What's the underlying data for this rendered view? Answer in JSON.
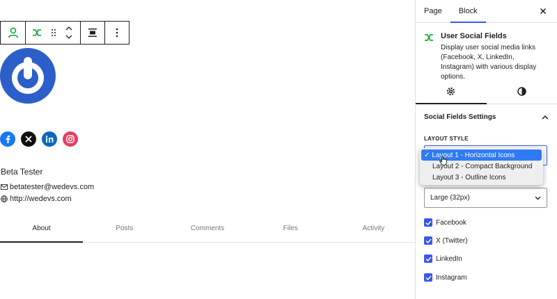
{
  "toolbar": {
    "buttons": [
      "block-type",
      "drag",
      "move",
      "align",
      "options"
    ]
  },
  "social_icons": [
    {
      "name": "facebook",
      "glyph": "f",
      "color": "#1877f2"
    },
    {
      "name": "x",
      "glyph": "X",
      "color": "#000000"
    },
    {
      "name": "linkedin",
      "glyph": "in",
      "color": "#0a66c2"
    },
    {
      "name": "instagram",
      "glyph": "◎",
      "color": "#e4405f"
    }
  ],
  "profile": {
    "name": "Beta Tester",
    "email": "betatester@wedevs.com",
    "url": "http://wedevs.com"
  },
  "profile_tabs": [
    "About",
    "Posts",
    "Comments",
    "Files",
    "Activity"
  ],
  "sidebar": {
    "tabs": [
      "Page",
      "Block"
    ],
    "block_title": "User Social Fields",
    "block_description": "Display user social media links (Facebook, X, LinkedIn, Instagram) with various display options.",
    "panel_title": "Social Fields Settings",
    "layout_label": "Layout Style",
    "layout_options": [
      "Layout 1 - Horizontal Icons",
      "Layout 2 - Compact Background",
      "Layout 3 - Outline Icons"
    ],
    "size_value": "Large (32px)",
    "checkboxes": [
      "Facebook",
      "X (Twitter)",
      "LinkedIn",
      "Instagram"
    ]
  },
  "colors": {
    "accent": "#3858e9",
    "brand_green": "#00a32a",
    "avatar_blue": "#2c5fc9"
  }
}
